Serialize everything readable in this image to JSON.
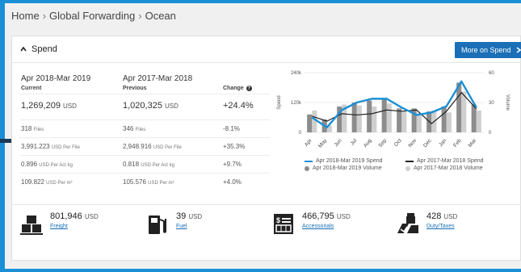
{
  "breadcrumb": {
    "items": [
      "Home",
      "Global Forwarding",
      "Ocean"
    ],
    "sep": "›"
  },
  "card": {
    "title": "Spend",
    "more_button": "More on Spend"
  },
  "table": {
    "period_current": "Apr 2018-Mar 2019",
    "period_previous": "Apr 2017-Mar 2018",
    "head_current": "Current",
    "head_previous": "Previous",
    "head_change": "Change",
    "rows": [
      {
        "cur": "1,269,209",
        "cur_u": "USD",
        "prev": "1,020,325",
        "prev_u": "USD",
        "chg": "+24.4%"
      },
      {
        "cur": "318",
        "cur_u": "Files",
        "prev": "346",
        "prev_u": "Files",
        "chg": "-8.1%"
      },
      {
        "cur": "3,991.223",
        "cur_u": "USD Per File",
        "prev": "2,948.916",
        "prev_u": "USD Per File",
        "chg": "+35.3%"
      },
      {
        "cur": "0.896",
        "cur_u": "USD Per Act kg",
        "prev": "0.818",
        "prev_u": "USD Per Act kg",
        "chg": "+9.7%"
      },
      {
        "cur": "109.822",
        "cur_u": "USD Per m²",
        "prev": "105.576",
        "prev_u": "USD Per m²",
        "chg": "+4.0%"
      }
    ]
  },
  "chart_data": {
    "type": "bar",
    "categories": [
      "Apr",
      "May",
      "Jun",
      "Jul",
      "Aug",
      "Sep",
      "Oct",
      "Nov",
      "Dec",
      "Jan",
      "Feb",
      "Mar"
    ],
    "ylabel": "Spend",
    "y2label": "Volume",
    "ylim": [
      0,
      240000
    ],
    "y2lim": [
      0,
      60
    ],
    "yticks": [
      "240k",
      "120k",
      "0"
    ],
    "y2ticks": [
      "60",
      "30",
      "0"
    ],
    "series": [
      {
        "name": "Apr 2018-Mar 2019 Volume",
        "kind": "bar",
        "axis": "y2",
        "values": [
          18,
          13,
          26,
          30,
          32,
          34,
          24,
          24,
          21,
          26,
          50,
          28
        ]
      },
      {
        "name": "Apr 2017-Mar 2018 Volume",
        "kind": "bar",
        "axis": "y2",
        "values": [
          22,
          7,
          28,
          27,
          26,
          29,
          21,
          19,
          22,
          20,
          41,
          22
        ]
      },
      {
        "name": "Apr 2018-Mar 2019 Spend",
        "kind": "line",
        "axis": "y",
        "values": [
          60000,
          20000,
          90000,
          120000,
          135000,
          135000,
          100000,
          70000,
          80000,
          105000,
          205000,
          100000
        ]
      },
      {
        "name": "Apr 2017-Mar 2018 Spend",
        "kind": "line",
        "axis": "y",
        "values": [
          65000,
          45000,
          75000,
          70000,
          75000,
          90000,
          85000,
          90000,
          35000,
          85000,
          160000,
          95000
        ]
      }
    ],
    "colors": {
      "spend_cur": "#1a8fd6",
      "spend_prev": "#222222",
      "vol_cur": "#8c8c8c",
      "vol_prev": "#cfcfcf"
    }
  },
  "metrics": [
    {
      "icon": "freight-icon",
      "value": "801,946",
      "unit": "USD",
      "link": "Freight"
    },
    {
      "icon": "fuel-icon",
      "value": "39",
      "unit": "USD",
      "link": "Fuel"
    },
    {
      "icon": "accessorials-icon",
      "value": "466,795",
      "unit": "USD",
      "link": "Accessorials"
    },
    {
      "icon": "duty-taxes-icon",
      "value": "428",
      "unit": "USD",
      "link": "Duty/Taxes"
    }
  ]
}
